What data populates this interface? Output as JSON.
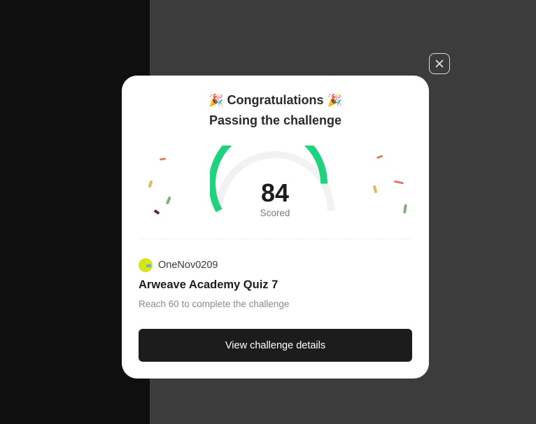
{
  "modal": {
    "title": "Congratulations",
    "title_emoji": "🎉",
    "subtitle": "Passing the challenge",
    "score": {
      "value": "84",
      "label": "Scored",
      "fraction": 0.84,
      "arc_color": "#1fd37e",
      "track_color": "#f2f2f2"
    },
    "creator": {
      "name": "OneNov0209",
      "avatar_icon": "avatar-icon"
    },
    "quiz_title": "Arweave Academy Quiz 7",
    "requirement": "Reach 60 to complete the challenge",
    "details_button": "View challenge details",
    "close_icon": "close-icon"
  },
  "colors": {
    "backdrop": "#3c3c3c",
    "left_panel": "#0f0f0f",
    "button_bg": "#1c1c1c",
    "confetti": [
      "#e07b6a",
      "#e5b85c",
      "#7fb07a",
      "#6b2a3a"
    ]
  }
}
